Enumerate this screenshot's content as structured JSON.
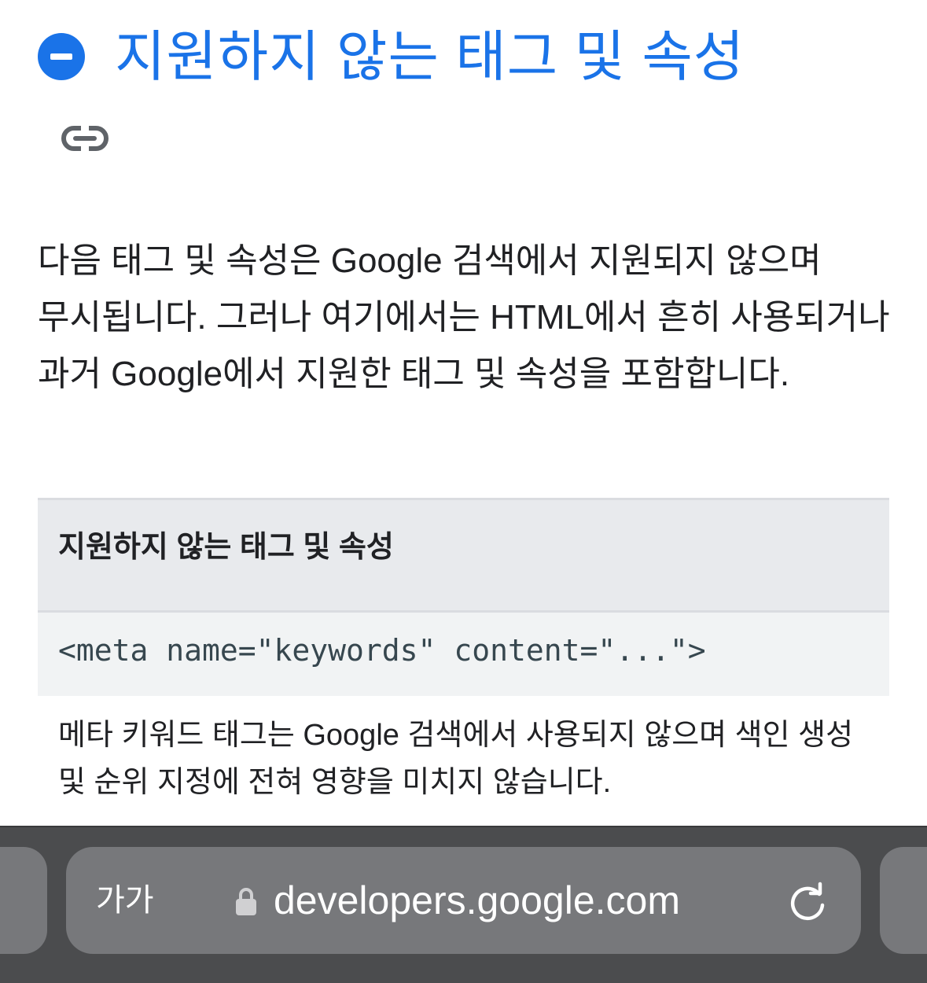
{
  "section": {
    "title": "지원하지 않는 태그 및 속성",
    "collapse_icon": "minus-circle-icon",
    "link_icon": "link-icon",
    "intro": "다음 태그 및 속성은 Google 검색에서 지원되지 않으며 무시됩니다. 그러나 여기에서는 HTML에서 흔히 사용되거나 과거 Google에서 지원한 태그 및 속성을 포함합니다."
  },
  "table": {
    "header": "지원하지 않는 태그 및 속성",
    "rows": [
      {
        "code": "<meta name=\"keywords\" content=\"...\">",
        "description": "메타 키워드 태그는 Google 검색에서 사용되지 않으며 색인 생성 및 순위 지정에 전혀 영향을 미치지 않습니다."
      }
    ]
  },
  "browser": {
    "text_size_label": "가가",
    "url": "developers.google.com",
    "lock_icon": "lock-icon",
    "reload_icon": "reload-icon"
  },
  "colors": {
    "accent": "#1a73e8",
    "text": "#202124",
    "table_header_bg": "#e8eaed",
    "code_bg": "#f1f3f4",
    "toolbar_bg": "#4b4c4e",
    "pill_bg": "#77787b"
  }
}
